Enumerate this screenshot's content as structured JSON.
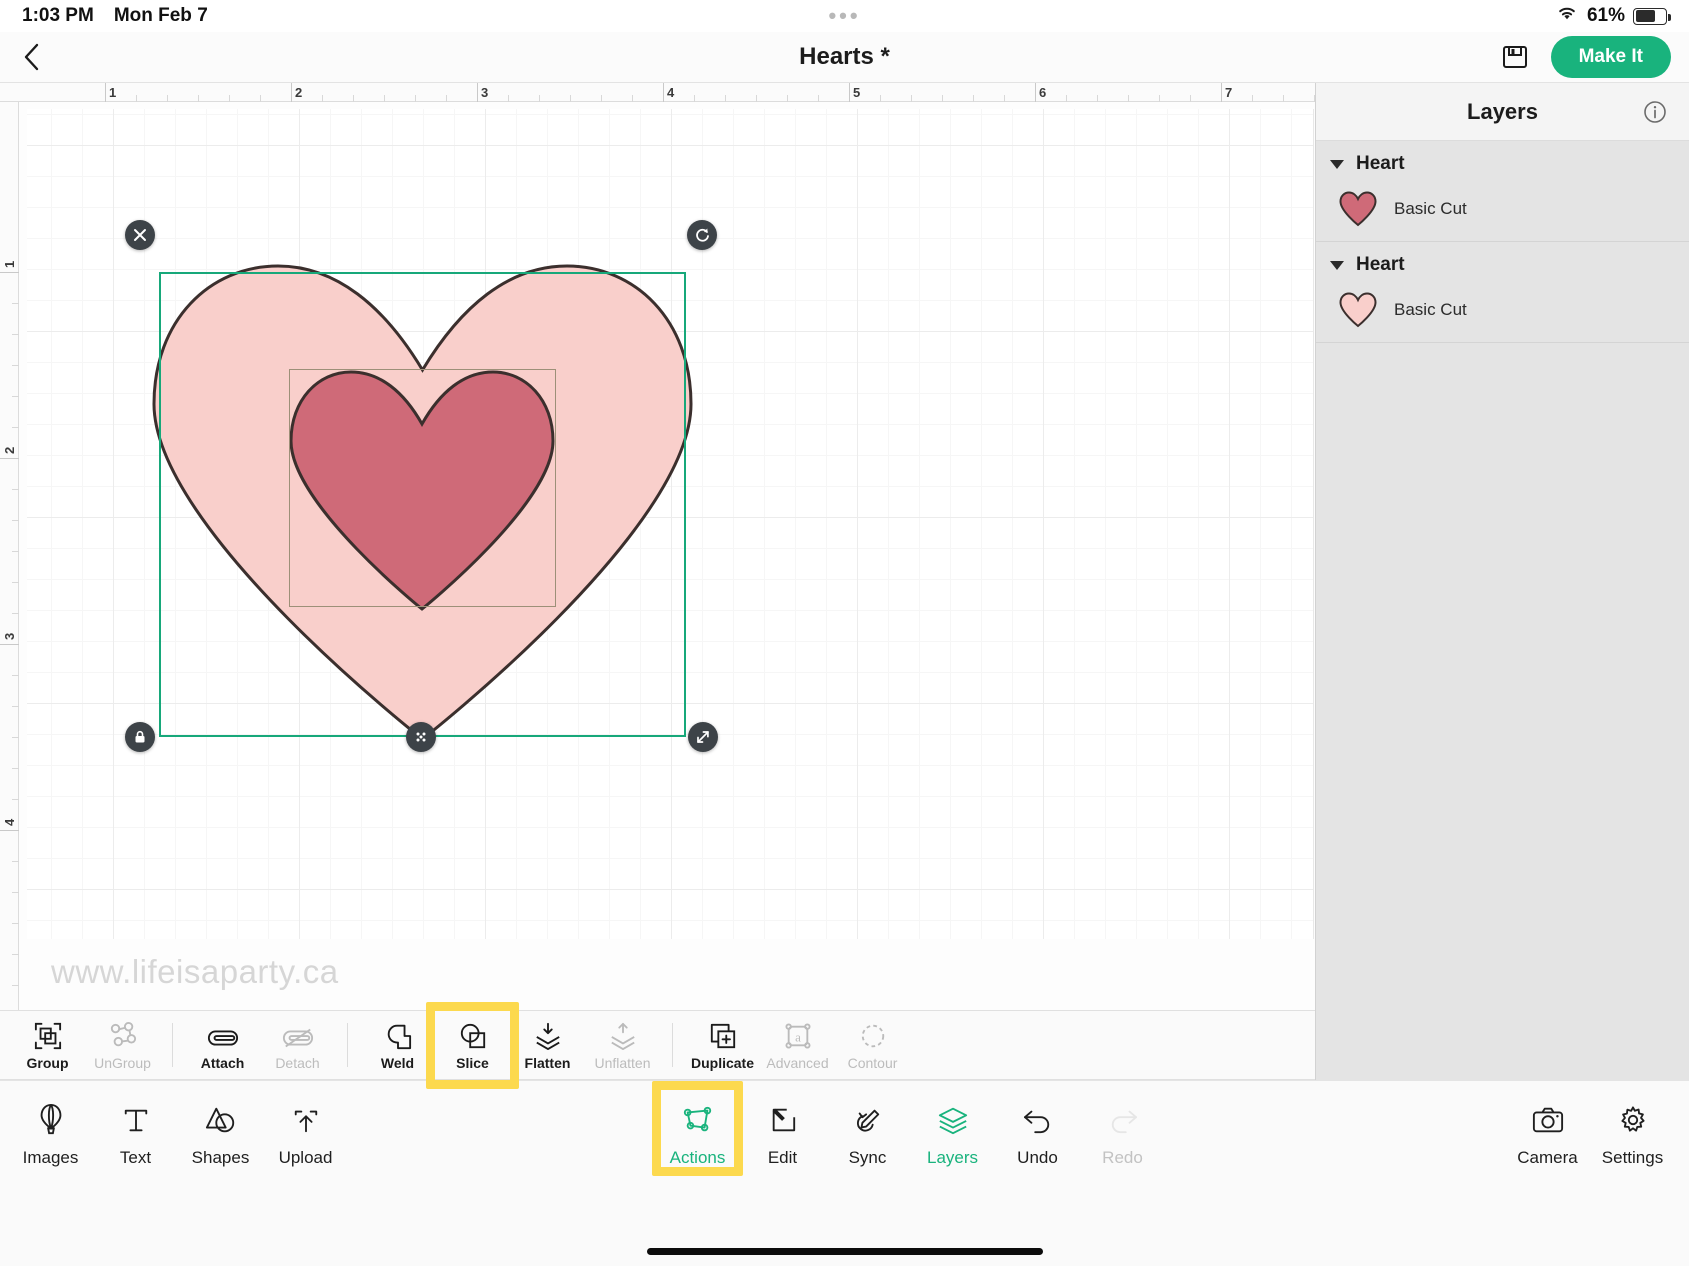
{
  "status_bar": {
    "time": "1:03 PM",
    "date": "Mon Feb 7",
    "battery_percent": "61%",
    "wifi_icon": "wifi-icon",
    "battery_icon": "battery-icon",
    "dots_icon": "multitask-dots-icon"
  },
  "top_bar": {
    "back_icon": "chevron-left-icon",
    "title": "Hearts *",
    "save_icon": "save-disk-icon",
    "make_it_label": "Make It",
    "accent_color": "#19b37d"
  },
  "canvas": {
    "ruler_h_labels": [
      "1",
      "2",
      "3",
      "4",
      "5",
      "6",
      "7"
    ],
    "ruler_v_labels": [
      "1",
      "2",
      "3",
      "4"
    ],
    "watermark": "www.lifeisaparty.ca",
    "selection_color": "#17a87a",
    "handles": [
      {
        "name": "delete-handle",
        "icon": "close-x-icon"
      },
      {
        "name": "rotate-handle",
        "icon": "rotate-icon"
      },
      {
        "name": "lock-aspect-handle",
        "icon": "lock-icon"
      },
      {
        "name": "move-handle",
        "icon": "move-dots-icon"
      },
      {
        "name": "resize-handle",
        "icon": "resize-diagonal-icon"
      }
    ],
    "shapes": [
      {
        "name": "heart-large-light",
        "fill": "#f9cfcb",
        "stroke": "#3b2f2d"
      },
      {
        "name": "heart-small-dark",
        "fill": "#cf6a78",
        "stroke": "#3b2f2d"
      }
    ]
  },
  "layers": {
    "title": "Layers",
    "info_icon": "info-circle-icon",
    "groups": [
      {
        "name": "Heart",
        "swatch_color": "#cf6a78",
        "sub_label": "Basic Cut"
      },
      {
        "name": "Heart",
        "swatch_color": "#f9cfcb",
        "sub_label": "Basic Cut"
      }
    ],
    "footer": [
      {
        "name": "duplicate-layer-button",
        "icon": "add-layer-icon"
      },
      {
        "name": "visibility-button",
        "icon": "eye-icon"
      },
      {
        "name": "delete-layer-button",
        "icon": "trash-icon"
      }
    ]
  },
  "operations": [
    {
      "label": "Group",
      "icon": "group-icon",
      "enabled": true,
      "highlighted": false
    },
    {
      "label": "UnGroup",
      "icon": "ungroup-icon",
      "enabled": false,
      "highlighted": false
    },
    {
      "label": "Attach",
      "icon": "attach-icon",
      "enabled": true,
      "highlighted": false
    },
    {
      "label": "Detach",
      "icon": "detach-icon",
      "enabled": false,
      "highlighted": false
    },
    {
      "label": "Weld",
      "icon": "weld-icon",
      "enabled": true,
      "highlighted": false
    },
    {
      "label": "Slice",
      "icon": "slice-icon",
      "enabled": true,
      "highlighted": true
    },
    {
      "label": "Flatten",
      "icon": "flatten-icon",
      "enabled": true,
      "highlighted": false
    },
    {
      "label": "Unflatten",
      "icon": "unflatten-icon",
      "enabled": false,
      "highlighted": false
    },
    {
      "label": "Duplicate",
      "icon": "duplicate-icon",
      "enabled": true,
      "highlighted": false
    },
    {
      "label": "Advanced",
      "icon": "advanced-icon",
      "enabled": false,
      "highlighted": false
    },
    {
      "label": "Contour",
      "icon": "contour-icon",
      "enabled": false,
      "highlighted": false
    }
  ],
  "bottom_nav": {
    "left": [
      {
        "label": "Images",
        "icon": "balloon-icon",
        "state": "normal"
      },
      {
        "label": "Text",
        "icon": "text-t-icon",
        "state": "normal"
      },
      {
        "label": "Shapes",
        "icon": "shapes-icon",
        "state": "normal"
      },
      {
        "label": "Upload",
        "icon": "upload-icon",
        "state": "normal"
      }
    ],
    "middle": [
      {
        "label": "Actions",
        "icon": "actions-node-icon",
        "state": "active"
      },
      {
        "label": "Edit",
        "icon": "edit-pen-icon",
        "state": "normal"
      },
      {
        "label": "Sync",
        "icon": "sync-pen-icon",
        "state": "normal"
      },
      {
        "label": "Layers",
        "icon": "layers-stack-icon",
        "state": "active"
      },
      {
        "label": "Undo",
        "icon": "undo-arrow-icon",
        "state": "normal"
      },
      {
        "label": "Redo",
        "icon": "redo-arrow-icon",
        "state": "disabled"
      }
    ],
    "right": [
      {
        "label": "Camera",
        "icon": "camera-icon",
        "state": "normal"
      },
      {
        "label": "Settings",
        "icon": "gear-icon",
        "state": "normal"
      }
    ],
    "highlight_color": "#fcd94e"
  }
}
